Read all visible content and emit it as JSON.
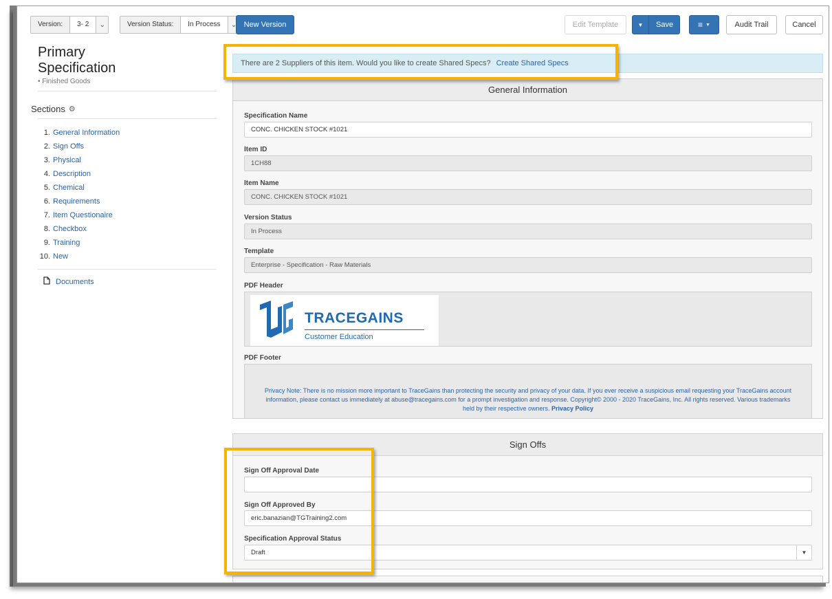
{
  "toolbar": {
    "version_label": "Version:",
    "version_value": "3- 2",
    "version_status_label": "Version Status:",
    "version_status_value": "In Process",
    "new_version": "New Version",
    "edit_template": "Edit Template",
    "save": "Save",
    "audit_trail": "Audit Trail",
    "cancel": "Cancel"
  },
  "sidebar": {
    "title_line1": "Primary",
    "title_line2": "Specification",
    "subtitle": "• Finished Goods",
    "sections_heading": "Sections",
    "items": [
      {
        "num": "1.",
        "label": "General Information"
      },
      {
        "num": "2.",
        "label": "Sign Offs"
      },
      {
        "num": "3.",
        "label": "Physical"
      },
      {
        "num": "4.",
        "label": "Description"
      },
      {
        "num": "5.",
        "label": "Chemical"
      },
      {
        "num": "6.",
        "label": "Requirements"
      },
      {
        "num": "7.",
        "label": "Item Questionaire"
      },
      {
        "num": "8.",
        "label": "Checkbox"
      },
      {
        "num": "9.",
        "label": "Training"
      },
      {
        "num": "10.",
        "label": "New"
      }
    ],
    "documents": "Documents"
  },
  "alert": {
    "text": "There are 2 Suppliers of this item. Would you like to create Shared Specs?",
    "link": "Create Shared Specs"
  },
  "general": {
    "heading": "General Information",
    "spec_name_label": "Specification Name",
    "spec_name_value": "CONC. CHICKEN STOCK #1021",
    "item_id_label": "Item ID",
    "item_id_value": "1CH88",
    "item_name_label": "Item Name",
    "item_name_value": "CONC. CHICKEN STOCK #1021",
    "version_status_label": "Version Status",
    "version_status_value": "In Process",
    "template_label": "Template",
    "template_value": "Enterprise - Specification - Raw Materials",
    "pdf_header_label": "PDF Header",
    "logo_text": "TRACEGAINS",
    "logo_subtext": "Customer Education",
    "pdf_footer_label": "PDF Footer",
    "footer_text": "Privacy Note: There is no mission more important to TraceGains than protecting the security and privacy of your data. If you ever receive a suspicious email requesting your TraceGains account information, please contact us immediately at abuse@tracegains.com for a prompt investigation and response. Copyright© 2000 - 2020 TraceGains, Inc. All rights reserved. Various trademarks held by their respective owners.",
    "footer_link": "Privacy Policy"
  },
  "signoffs": {
    "heading": "Sign Offs",
    "approval_date_label": "Sign Off Approval Date",
    "approval_date_value": "",
    "approved_by_label": "Sign Off Approved By",
    "approved_by_value": "eric.banazian@TGTraining2.com",
    "approval_status_label": "Specification Approval Status",
    "approval_status_value": "Draft"
  },
  "colors": {
    "primary": "#3574b4",
    "link": "#2a63a8",
    "highlight": "#f4b400",
    "alert_bg": "#d9edf4"
  }
}
